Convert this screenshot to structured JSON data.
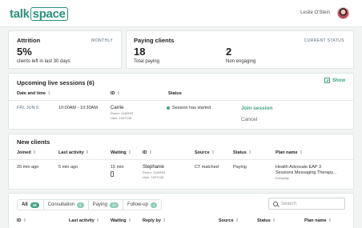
{
  "header": {
    "logo_left": "talk",
    "logo_right": "space",
    "user_name": "Leslie O'Stein"
  },
  "attrition": {
    "title": "Attrition",
    "period": "MONTHLY",
    "value": "5%",
    "caption": "clients left in last 30 days"
  },
  "paying": {
    "title": "Paying clients",
    "status_link": "CURRENT STATUS",
    "total_value": "18",
    "total_label": "Total paying",
    "nonengaging_value": "2",
    "nonengaging_label": "Non engaging"
  },
  "sessions": {
    "title": "Upcoming live sessions (6)",
    "show_label": "Show",
    "columns": [
      "Date and time",
      "ID",
      "Status"
    ],
    "row": {
      "date": "FRI, JUN 5",
      "time": "10:00AM - 10:30AM",
      "name": "Carrie",
      "room": "Room: 1145933",
      "user": "User: 1097138",
      "status": "Session has started",
      "join": "Join session",
      "cancel": "Cancel"
    }
  },
  "new_clients": {
    "title": "New clients",
    "columns": [
      "Joined",
      "Last activity",
      "Waiting",
      "ID",
      "Source",
      "Status",
      "Plan name"
    ],
    "row": {
      "joined": "20 min ago",
      "last_activity": "5 min ago",
      "waiting": "15 min",
      "name": "Stephanie",
      "room": "Room: 1145933",
      "user": "User: 1097138",
      "source": "CT matched",
      "status": "Paying",
      "plan_line1": "Health Advocate EAP 3",
      "plan_line2": "Sessions Messaging Therapy...",
      "plan_sub": "Everyday"
    }
  },
  "caseload": {
    "tabs": [
      {
        "label": "All",
        "count": "18"
      },
      {
        "label": "Consultation",
        "count": "4"
      },
      {
        "label": "Paying",
        "count": "10"
      },
      {
        "label": "Follow-up",
        "count": "4"
      }
    ],
    "search_placeholder": "Search",
    "columns": [
      "ID",
      "Last activity",
      "Waiting",
      "Reply by",
      "Source",
      "Status",
      "Plan name"
    ]
  },
  "colors": {
    "accent": "#3ea383",
    "brand": "#2a8f7c"
  }
}
